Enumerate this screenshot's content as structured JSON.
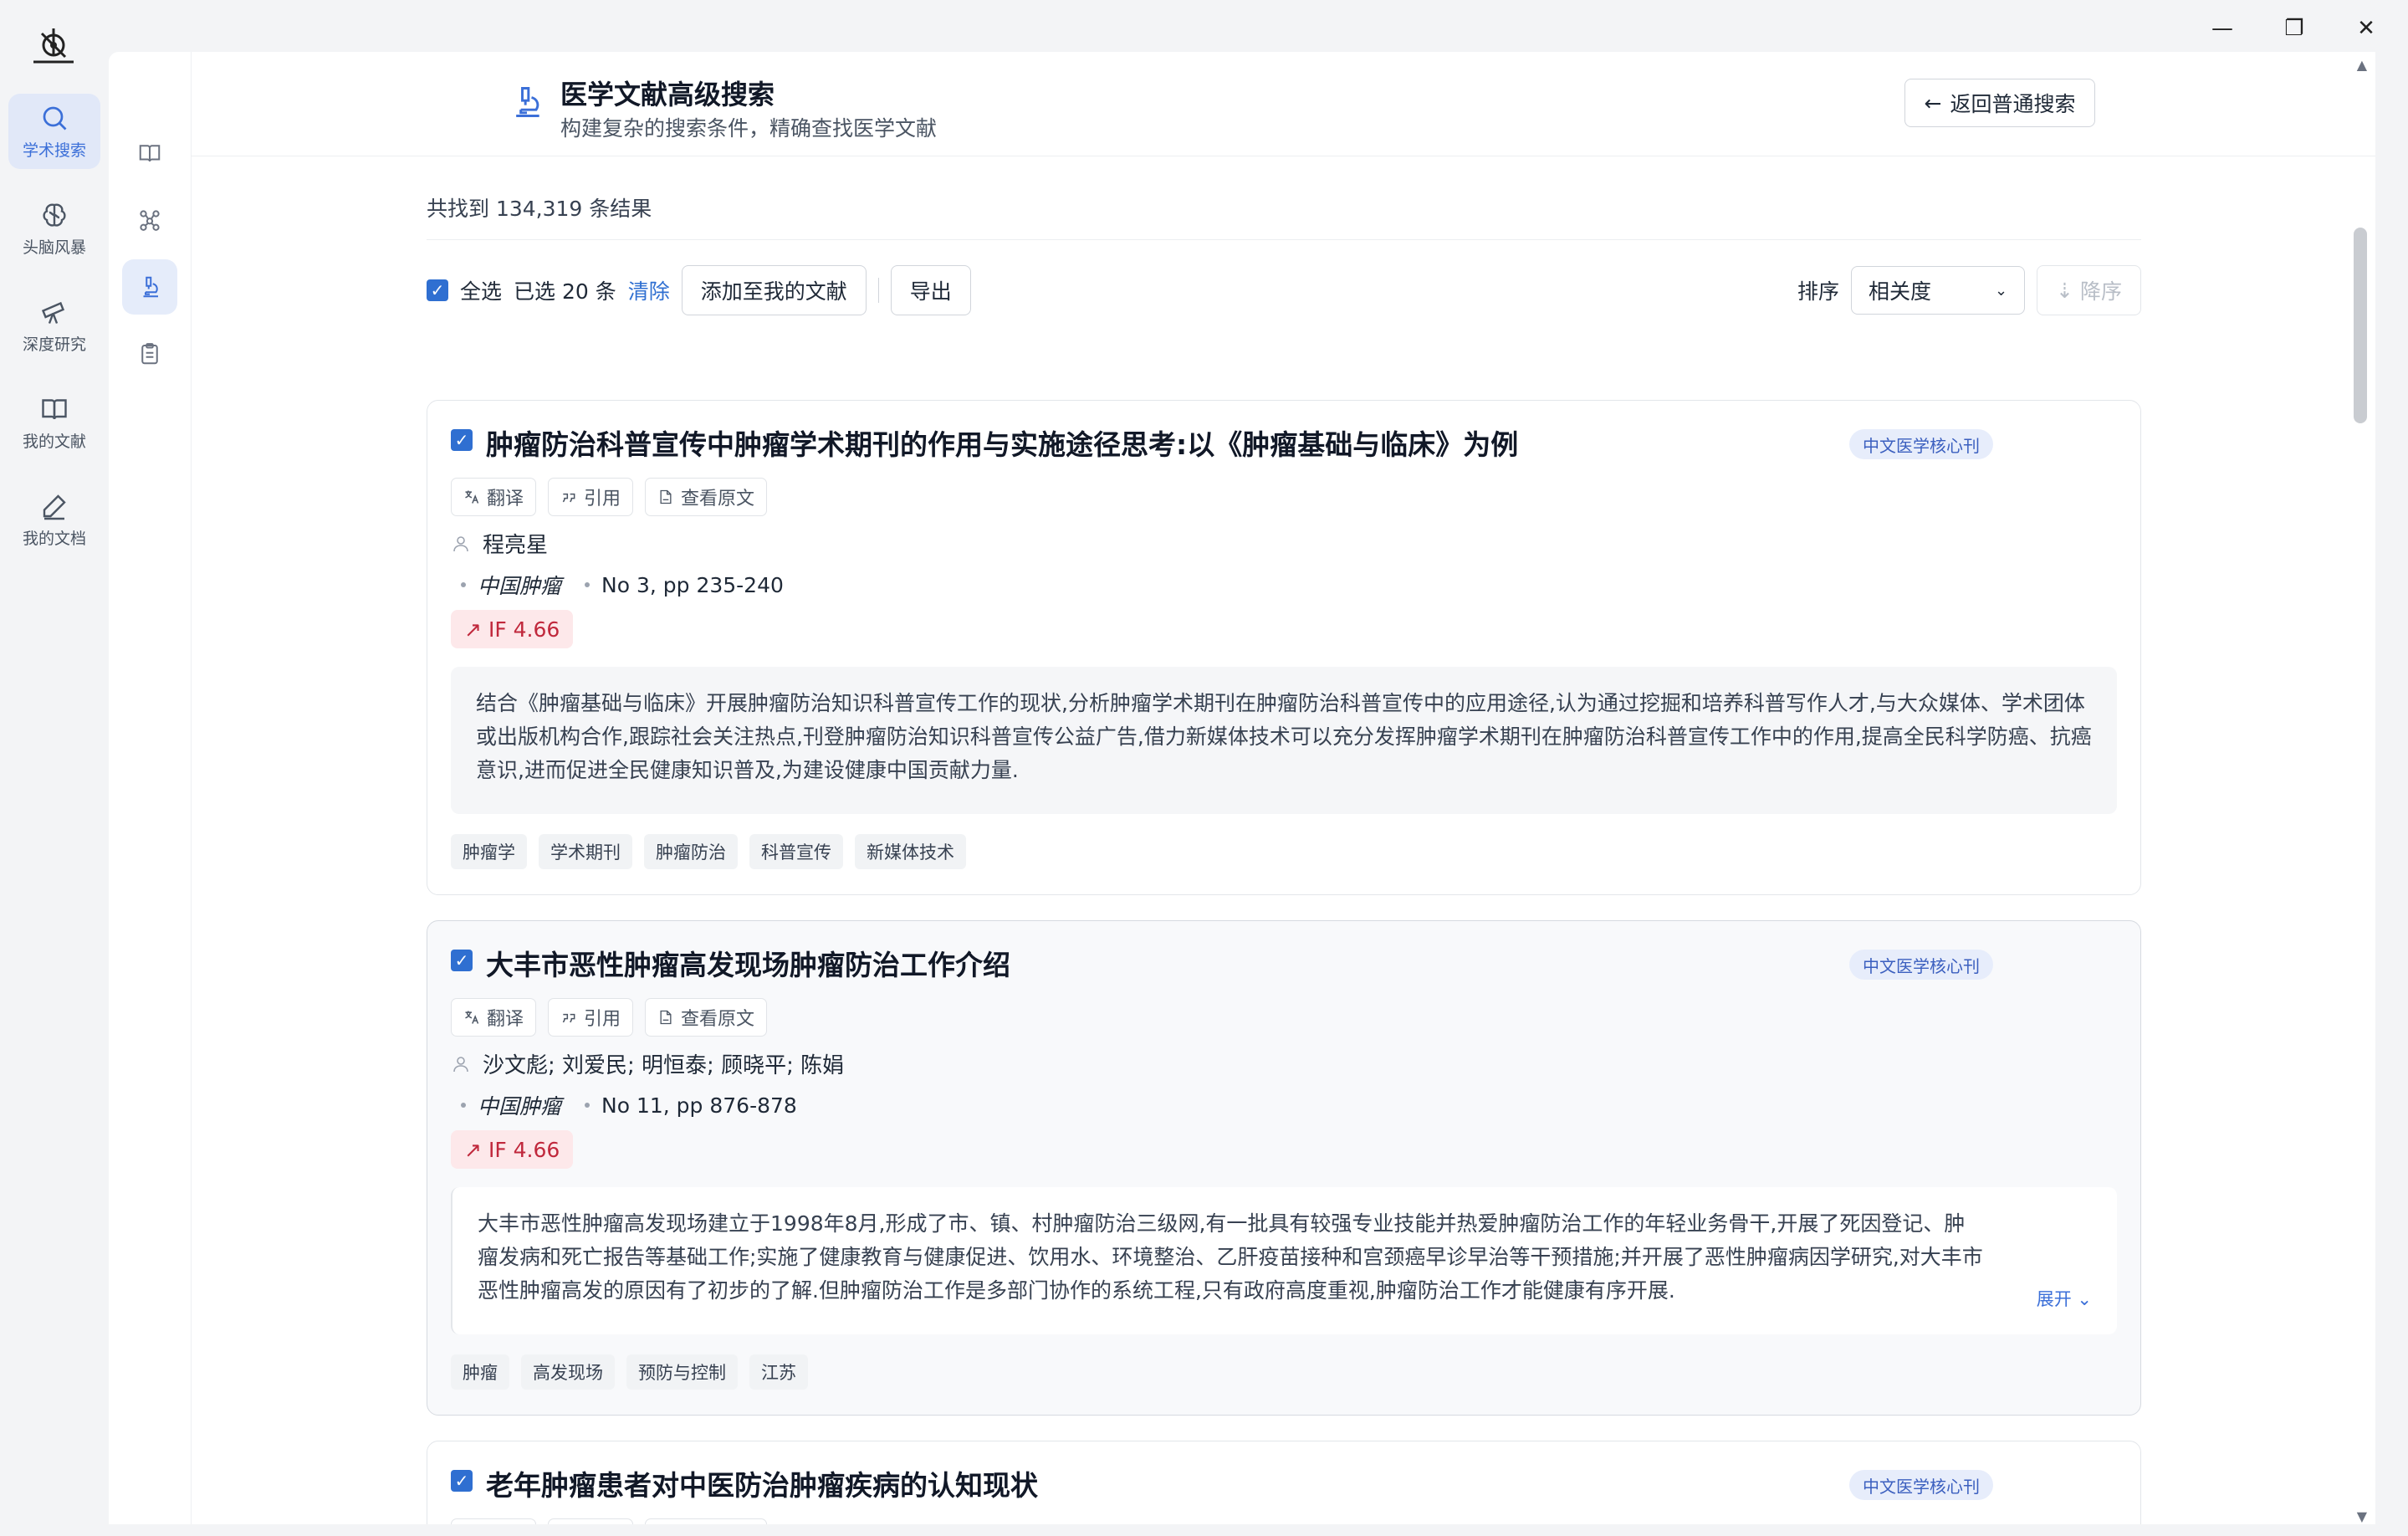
{
  "window": {
    "min": "—",
    "restore": "❐",
    "close": "✕"
  },
  "nav": {
    "items": [
      {
        "label": "学术搜索",
        "icon": "search-icon",
        "active": true
      },
      {
        "label": "头脑风暴",
        "icon": "brain-icon",
        "active": false
      },
      {
        "label": "深度研究",
        "icon": "telescope-icon",
        "active": false
      },
      {
        "label": "我的文献",
        "icon": "book-icon",
        "active": false
      },
      {
        "label": "我的文档",
        "icon": "pen-icon",
        "active": false
      }
    ]
  },
  "header": {
    "title": "医学文献高级搜索",
    "subtitle": "构建复杂的搜索条件，精确查找医学文献",
    "back_label": "返回普通搜索"
  },
  "results": {
    "count_text": "共找到 134,319 条结果"
  },
  "toolbar": {
    "select_all": "全选",
    "selected": "已选 20 条",
    "clear": "清除",
    "add_to_library": "添加至我的文献",
    "export": "导出",
    "sort_label": "排序",
    "sort_value": "相关度",
    "order": "降序"
  },
  "card_actions": {
    "translate": "翻译",
    "cite": "引用",
    "view_original": "查看原文"
  },
  "items": [
    {
      "title": "肿瘤防治科普宣传中肿瘤学术期刊的作用与实施途径思考:以《肿瘤基础与临床》为例",
      "badge": "中文医学核心刊",
      "authors": "程亮星",
      "journal": "中国肿瘤",
      "issue": "No 3, pp 235-240",
      "if": "IF 4.66",
      "abstract": "结合《肿瘤基础与临床》开展肿瘤防治知识科普宣传工作的现状,分析肿瘤学术期刊在肿瘤防治科普宣传中的应用途径,认为通过挖掘和培养科普写作人才,与大众媒体、学术团体或出版机构合作,跟踪社会关注热点,刊登肿瘤防治知识科普宣传公益广告,借力新媒体技术可以充分发挥肿瘤学术期刊在肿瘤防治科普宣传工作中的作用,提高全民科学防癌、抗癌意识,进而促进全民健康知识普及,为建设健康中国贡献力量.",
      "tags": [
        "肿瘤学",
        "学术期刊",
        "肿瘤防治",
        "科普宣传",
        "新媒体技术"
      ]
    },
    {
      "title": "大丰市恶性肿瘤高发现场肿瘤防治工作介绍",
      "badge": "中文医学核心刊",
      "authors": "沙文彪; 刘爱民; 明恒泰; 顾晓平; 陈娟",
      "journal": "中国肿瘤",
      "issue": "No 11, pp 876-878",
      "if": "IF 4.66",
      "abstract": "大丰市恶性肿瘤高发现场建立于1998年8月,形成了市、镇、村肿瘤防治三级网,有一批具有较强专业技能并热爱肿瘤防治工作的年轻业务骨干,开展了死因登记、肿瘤发病和死亡报告等基础工作;实施了健康教育与健康促进、饮用水、环境整治、乙肝疫苗接种和宫颈癌早诊早治等干预措施;并开展了恶性肿瘤病因学研究,对大丰市恶性肿瘤高发的原因有了初步的了解.但肿瘤防治工作是多部门协作的系统工程,只有政府高度重视,肿瘤防治工作才能健康有序开展.",
      "expand": "展开",
      "tags": [
        "肿瘤",
        "高发现场",
        "预防与控制",
        "江苏"
      ]
    },
    {
      "title": "老年肿瘤患者对中医防治肿瘤疾病的认知现状",
      "badge": "中文医学核心刊"
    }
  ]
}
